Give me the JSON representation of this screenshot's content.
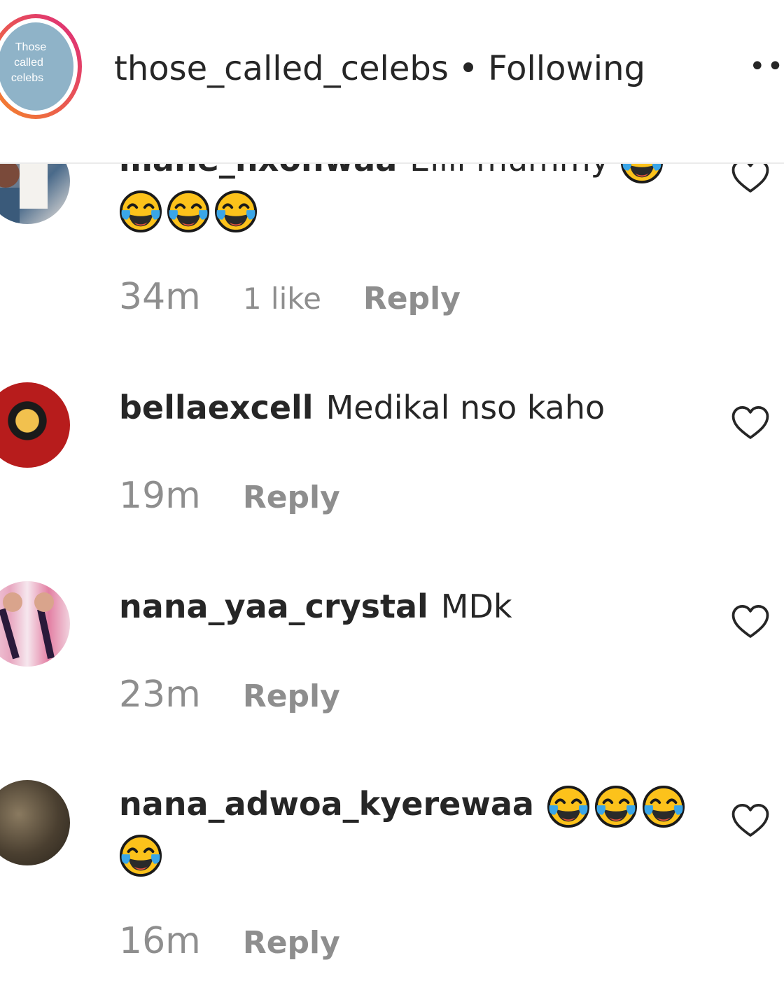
{
  "header": {
    "username": "those_called_celebs",
    "separator": "•",
    "follow_status": "Following",
    "more_label": "••",
    "avatar_text": [
      "Those",
      "called",
      "celebs"
    ]
  },
  "comments": [
    {
      "username": "mane_nxonwaa",
      "text": "Eiiii mummy",
      "emojis_line1": 1,
      "emojis_line2": 3,
      "time": "34m",
      "likes": "1 like",
      "reply": "Reply"
    },
    {
      "username": "bellaexcell",
      "text": "Medikal nso kaho",
      "time": "19m",
      "reply": "Reply"
    },
    {
      "username": "nana_yaa_crystal",
      "text": "MDk",
      "time": "23m",
      "reply": "Reply"
    },
    {
      "username": "nana_adwoa_kyerewaa",
      "text": "",
      "emojis_line1": 3,
      "emojis_line2": 1,
      "time": "16m",
      "reply": "Reply"
    }
  ],
  "colors": {
    "text": "#262626",
    "meta": "#8e8e8e",
    "story_ring_start": "#f58529",
    "story_ring_end": "#dd2a7b",
    "avatar_bg": "#8fb3c8"
  }
}
